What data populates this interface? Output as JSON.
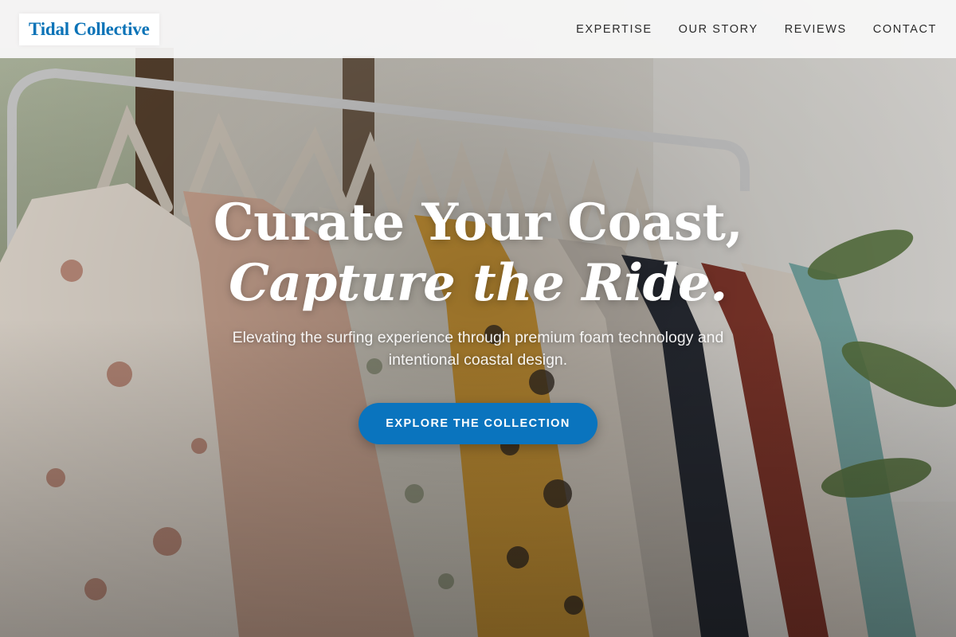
{
  "header": {
    "logo": "Tidal Collective",
    "nav": [
      {
        "label": "EXPERTISE"
      },
      {
        "label": "OUR STORY"
      },
      {
        "label": "REVIEWS"
      },
      {
        "label": "CONTACT"
      }
    ]
  },
  "hero": {
    "headline_line1": "Curate Your Coast,",
    "headline_line2": "Capture the Ride.",
    "subtitle": "Elevating the surfing experience through premium foam technology and intentional coastal design.",
    "cta_label": "EXPLORE THE COLLECTION",
    "background_image": "clothing-rack-photo"
  },
  "colors": {
    "brand_blue": "#0b73b7",
    "cta_blue": "#0a74be",
    "header_bg": "#f8f8f8",
    "nav_text": "#2b2b2b",
    "hero_text": "#ffffff"
  }
}
